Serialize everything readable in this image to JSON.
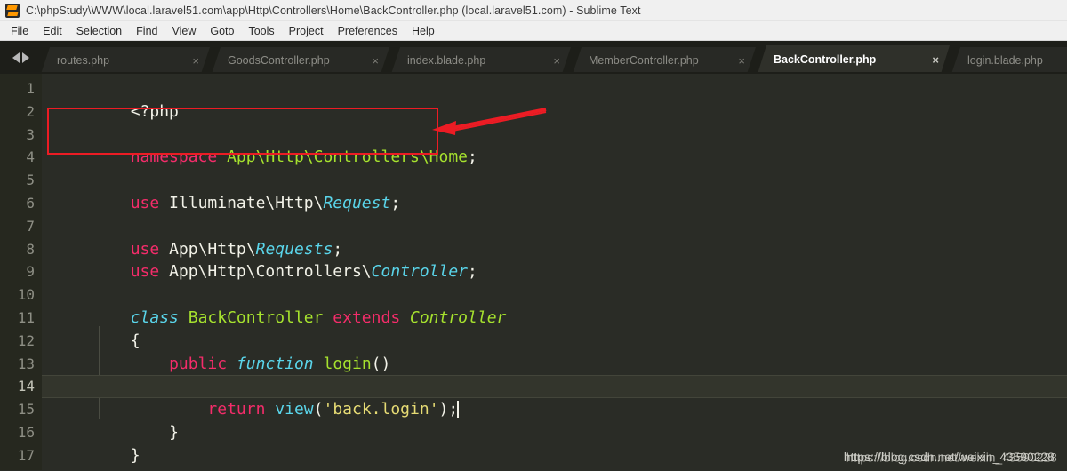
{
  "window": {
    "title": "C:\\phpStudy\\WWW\\local.laravel51.com\\app\\Http\\Controllers\\Home\\BackController.php (local.laravel51.com) - Sublime Text",
    "app_icon": "sublime-text-icon"
  },
  "menubar": {
    "items": [
      {
        "label": "File",
        "mnemonic": "F"
      },
      {
        "label": "Edit",
        "mnemonic": "E"
      },
      {
        "label": "Selection",
        "mnemonic": "S"
      },
      {
        "label": "Find",
        "mnemonic": "n"
      },
      {
        "label": "View",
        "mnemonic": "V"
      },
      {
        "label": "Goto",
        "mnemonic": "G"
      },
      {
        "label": "Tools",
        "mnemonic": "T"
      },
      {
        "label": "Project",
        "mnemonic": "P"
      },
      {
        "label": "Preferences",
        "mnemonic": "n"
      },
      {
        "label": "Help",
        "mnemonic": "H"
      }
    ]
  },
  "tabbar": {
    "nav_prev_icon": "chevron-left-icon",
    "nav_next_icon": "chevron-right-icon",
    "close_icon": "×",
    "tabs": [
      {
        "label": "routes.php",
        "active": false
      },
      {
        "label": "GoodsController.php",
        "active": false
      },
      {
        "label": "index.blade.php",
        "active": false
      },
      {
        "label": "MemberController.php",
        "active": false
      },
      {
        "label": "BackController.php",
        "active": true
      },
      {
        "label": "login.blade.php",
        "active": false
      }
    ]
  },
  "editor": {
    "line_numbers": [
      "1",
      "2",
      "3",
      "4",
      "5",
      "6",
      "7",
      "8",
      "9",
      "10",
      "11",
      "12",
      "13",
      "14",
      "15",
      "16",
      "17"
    ],
    "highlighted_line": 14,
    "caret_line": 14,
    "lines": [
      {
        "n": 1,
        "text": "<?php"
      },
      {
        "n": 2,
        "text": ""
      },
      {
        "n": 3,
        "text": "namespace App\\Http\\Controllers\\Home;"
      },
      {
        "n": 4,
        "text": ""
      },
      {
        "n": 5,
        "text": "use Illuminate\\Http\\Request;"
      },
      {
        "n": 6,
        "text": ""
      },
      {
        "n": 7,
        "text": "use App\\Http\\Requests;"
      },
      {
        "n": 8,
        "text": "use App\\Http\\Controllers\\Controller;"
      },
      {
        "n": 9,
        "text": ""
      },
      {
        "n": 10,
        "text": "class BackController extends Controller"
      },
      {
        "n": 11,
        "text": "{"
      },
      {
        "n": 12,
        "text": "    public function login()"
      },
      {
        "n": 13,
        "text": "    {"
      },
      {
        "n": 14,
        "text": "        return view('back.login');"
      },
      {
        "n": 15,
        "text": "    }"
      },
      {
        "n": 16,
        "text": "}"
      },
      {
        "n": 17,
        "text": ""
      }
    ],
    "tokens": {
      "l1_open_tag": "<?php",
      "l3_kw": "namespace",
      "l3_path": "App\\Http\\Controllers\\Home",
      "l3_semi": ";",
      "l5_kw": "use",
      "l5_ns": "Illuminate\\Http\\",
      "l5_type": "Request",
      "l5_semi": ";",
      "l7_kw": "use",
      "l7_ns": "App\\Http\\",
      "l7_type": "Requests",
      "l7_semi": ";",
      "l8_kw": "use",
      "l8_ns": "App\\Http\\Controllers\\",
      "l8_type": "Controller",
      "l8_semi": ";",
      "l10_class_kw": "class",
      "l10_class_name": "BackController",
      "l10_extends_kw": "extends",
      "l10_parent": "Controller",
      "l11_brace": "{",
      "l12_visibility": "public",
      "l12_function_kw": "function",
      "l12_fn_name": "login",
      "l12_parens": "()",
      "l13_brace": "{",
      "l14_return_kw": "return",
      "l14_fn": "view",
      "l14_open_paren": "(",
      "l14_string": "'back.login'",
      "l14_close": ");",
      "l15_brace": "}",
      "l16_brace": "}"
    }
  },
  "annotations": {
    "highlight_box": {
      "label": "namespace-highlight-box",
      "color": "#ec1c24"
    },
    "arrow": {
      "label": "pointer-arrow",
      "color": "#ec1c24"
    }
  },
  "watermark": {
    "text": "https://blog.csdn.net/weixin_43590228"
  },
  "colors": {
    "editor_bg": "#2a2c26",
    "gutter_bg": "#26281f",
    "tabbar_bg": "#1d1e19",
    "tab_active_bg": "#2f302a",
    "titlebar_bg": "#f0f0f0",
    "keyword": "#f42c6a",
    "storage": "#5ad5ea",
    "entity": "#a6e22e",
    "string": "#e6db74",
    "text": "#f2f2e8",
    "annotation_red": "#ec1c24"
  }
}
